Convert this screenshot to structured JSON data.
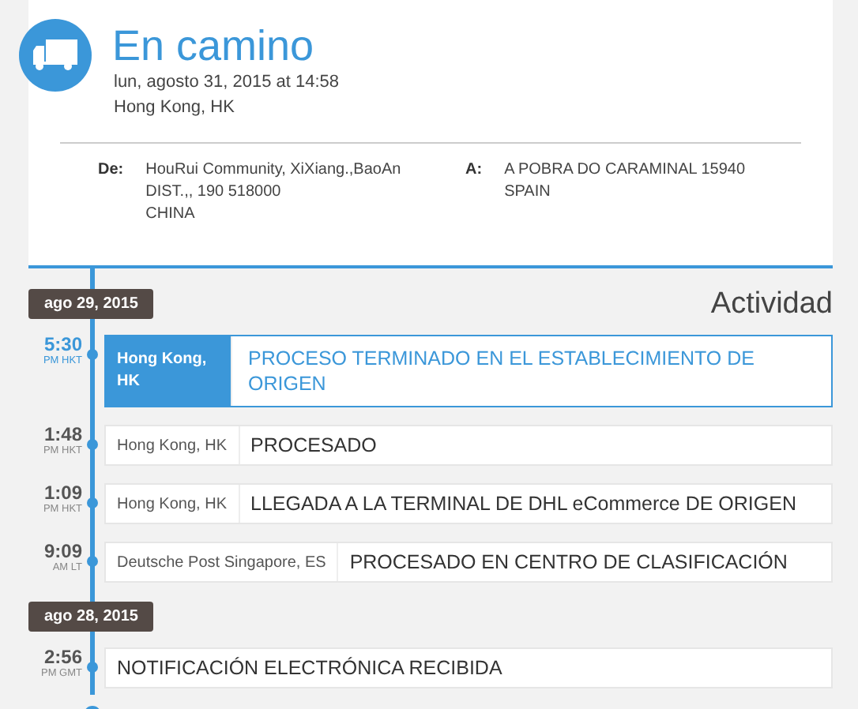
{
  "status": {
    "title": "En camino",
    "datetime": "lun, agosto 31, 2015 at 14:58",
    "location": "Hong Kong, HK"
  },
  "from": {
    "label": "De:",
    "lines": [
      "HouRui Community, XiXiang.,BaoAn",
      "DIST.,, 190 518000",
      "CHINA"
    ]
  },
  "to": {
    "label": "A:",
    "lines": [
      "A POBRA DO CARAMINAL 15940",
      "SPAIN"
    ]
  },
  "activity_title": "Actividad",
  "groups": [
    {
      "date": "ago 29, 2015",
      "events": [
        {
          "time": "5:30",
          "zone": "PM HKT",
          "location": "Hong Kong, HK",
          "description": "PROCESO TERMINADO EN EL ESTABLECIMIENTO DE ORIGEN",
          "selected": true
        },
        {
          "time": "1:48",
          "zone": "PM HKT",
          "location": "Hong Kong, HK",
          "description": "PROCESADO",
          "selected": false
        },
        {
          "time": "1:09",
          "zone": "PM HKT",
          "location": "Hong Kong, HK",
          "description": "LLEGADA A LA TERMINAL DE DHL eCommerce DE ORIGEN",
          "selected": false
        },
        {
          "time": "9:09",
          "zone": "AM LT",
          "location": "Deutsche Post Singapore, ES",
          "description": "PROCESADO EN CENTRO DE CLASIFICACIÓN",
          "selected": false
        }
      ]
    },
    {
      "date": "ago 28, 2015",
      "events": [
        {
          "time": "2:56",
          "zone": "PM GMT",
          "description": "NOTIFICACIÓN ELECTRÓNICA RECIBIDA",
          "selected": false
        }
      ]
    }
  ]
}
